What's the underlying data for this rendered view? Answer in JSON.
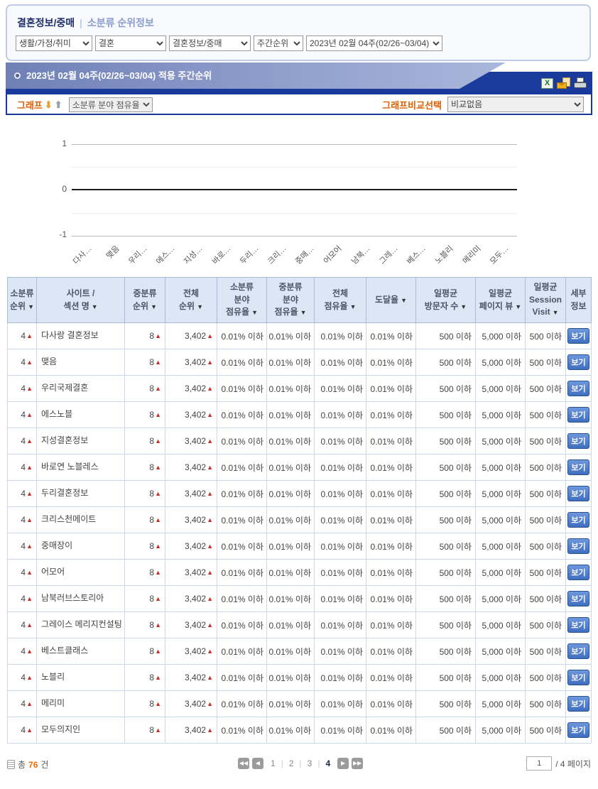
{
  "filter": {
    "title": "결혼정보/중매",
    "divider": "|",
    "subtitle": "소분류 순위정보",
    "selects": [
      "생활/가정/취미",
      "결혼",
      "결혼정보/중매",
      "주간순위",
      "2023년 02월 04주(02/26~03/04)"
    ]
  },
  "section": {
    "title": "2023년  02월  04주(02/26~03/04) 적용 주간순위",
    "graph_label": "그래프",
    "graph_select": "소분류 분야 점유율",
    "compare_label": "그래프비교선택",
    "compare_select": "비교없음",
    "icons": {
      "down": "⬇",
      "up": "⬆",
      "excel": "X"
    }
  },
  "chart_data": {
    "type": "line",
    "title": "",
    "categories": [
      "다사…",
      "맺음",
      "우리…",
      "에스…",
      "지성…",
      "바로…",
      "두리…",
      "크리…",
      "중매…",
      "어모어",
      "남북…",
      "그레…",
      "베스…",
      "노블리",
      "메리미",
      "모두…"
    ],
    "series": [],
    "ylim": [
      -1,
      1
    ],
    "yticks": [
      1,
      0,
      -1
    ],
    "ytick_labels": [
      "1",
      "0",
      "-1"
    ],
    "grid": true,
    "legend_position": "none"
  },
  "table": {
    "sort_glyph": "▼",
    "columns": [
      {
        "label": "소분류\n순위",
        "sort": true
      },
      {
        "label": "사이트 /\n섹션 명",
        "sort": true
      },
      {
        "label": "중분류\n순위",
        "sort": true
      },
      {
        "label": "전체\n순위",
        "sort": true
      },
      {
        "label": "소분류\n분야\n점유율",
        "sort": true
      },
      {
        "label": "중분류\n분야\n점유율",
        "sort": true
      },
      {
        "label": "전체\n점유율",
        "sort": true
      },
      {
        "label": "도달율",
        "sort": true
      },
      {
        "label": "일평균\n방문자 수",
        "sort": true
      },
      {
        "label": "일평균\n페이지 뷰",
        "sort": true
      },
      {
        "label": "일평균\nSession\nVisit",
        "sort": true
      },
      {
        "label": "세부\n정보",
        "sort": false
      }
    ],
    "rows": [
      {
        "rank": "4",
        "up": "▲",
        "site": "다사랑 결혼정보",
        "mid": "8",
        "mid_up": "▲",
        "total": "3,402",
        "total_up": "▲",
        "s1": "0.01% 이하",
        "s2": "0.01% 이하",
        "s3": "0.01% 이하",
        "s4": "0.01% 이하",
        "visitors": "500 이하",
        "pv": "5,000 이하",
        "session": "500 이하",
        "view": "보기"
      },
      {
        "rank": "4",
        "up": "▲",
        "site": "맺음",
        "mid": "8",
        "mid_up": "▲",
        "total": "3,402",
        "total_up": "▲",
        "s1": "0.01% 이하",
        "s2": "0.01% 이하",
        "s3": "0.01% 이하",
        "s4": "0.01% 이하",
        "visitors": "500 이하",
        "pv": "5,000 이하",
        "session": "500 이하",
        "view": "보기"
      },
      {
        "rank": "4",
        "up": "▲",
        "site": "우리국제결혼",
        "mid": "8",
        "mid_up": "▲",
        "total": "3,402",
        "total_up": "▲",
        "s1": "0.01% 이하",
        "s2": "0.01% 이하",
        "s3": "0.01% 이하",
        "s4": "0.01% 이하",
        "visitors": "500 이하",
        "pv": "5,000 이하",
        "session": "500 이하",
        "view": "보기"
      },
      {
        "rank": "4",
        "up": "▲",
        "site": "에스노블",
        "mid": "8",
        "mid_up": "▲",
        "total": "3,402",
        "total_up": "▲",
        "s1": "0.01% 이하",
        "s2": "0.01% 이하",
        "s3": "0.01% 이하",
        "s4": "0.01% 이하",
        "visitors": "500 이하",
        "pv": "5,000 이하",
        "session": "500 이하",
        "view": "보기"
      },
      {
        "rank": "4",
        "up": "▲",
        "site": "지성결혼정보",
        "mid": "8",
        "mid_up": "▲",
        "total": "3,402",
        "total_up": "▲",
        "s1": "0.01% 이하",
        "s2": "0.01% 이하",
        "s3": "0.01% 이하",
        "s4": "0.01% 이하",
        "visitors": "500 이하",
        "pv": "5,000 이하",
        "session": "500 이하",
        "view": "보기"
      },
      {
        "rank": "4",
        "up": "▲",
        "site": "바로연 노블레스",
        "mid": "8",
        "mid_up": "▲",
        "total": "3,402",
        "total_up": "▲",
        "s1": "0.01% 이하",
        "s2": "0.01% 이하",
        "s3": "0.01% 이하",
        "s4": "0.01% 이하",
        "visitors": "500 이하",
        "pv": "5,000 이하",
        "session": "500 이하",
        "view": "보기"
      },
      {
        "rank": "4",
        "up": "▲",
        "site": "두리결혼정보",
        "mid": "8",
        "mid_up": "▲",
        "total": "3,402",
        "total_up": "▲",
        "s1": "0.01% 이하",
        "s2": "0.01% 이하",
        "s3": "0.01% 이하",
        "s4": "0.01% 이하",
        "visitors": "500 이하",
        "pv": "5,000 이하",
        "session": "500 이하",
        "view": "보기"
      },
      {
        "rank": "4",
        "up": "▲",
        "site": "크리스천메이트",
        "mid": "8",
        "mid_up": "▲",
        "total": "3,402",
        "total_up": "▲",
        "s1": "0.01% 이하",
        "s2": "0.01% 이하",
        "s3": "0.01% 이하",
        "s4": "0.01% 이하",
        "visitors": "500 이하",
        "pv": "5,000 이하",
        "session": "500 이하",
        "view": "보기"
      },
      {
        "rank": "4",
        "up": "▲",
        "site": "중매장이",
        "mid": "8",
        "mid_up": "▲",
        "total": "3,402",
        "total_up": "▲",
        "s1": "0.01% 이하",
        "s2": "0.01% 이하",
        "s3": "0.01% 이하",
        "s4": "0.01% 이하",
        "visitors": "500 이하",
        "pv": "5,000 이하",
        "session": "500 이하",
        "view": "보기"
      },
      {
        "rank": "4",
        "up": "▲",
        "site": "어모어",
        "mid": "8",
        "mid_up": "▲",
        "total": "3,402",
        "total_up": "▲",
        "s1": "0.01% 이하",
        "s2": "0.01% 이하",
        "s3": "0.01% 이하",
        "s4": "0.01% 이하",
        "visitors": "500 이하",
        "pv": "5,000 이하",
        "session": "500 이하",
        "view": "보기"
      },
      {
        "rank": "4",
        "up": "▲",
        "site": "남북러브스토리아",
        "mid": "8",
        "mid_up": "▲",
        "total": "3,402",
        "total_up": "▲",
        "s1": "0.01% 이하",
        "s2": "0.01% 이하",
        "s3": "0.01% 이하",
        "s4": "0.01% 이하",
        "visitors": "500 이하",
        "pv": "5,000 이하",
        "session": "500 이하",
        "view": "보기"
      },
      {
        "rank": "4",
        "up": "▲",
        "site": "그레이스 메리지컨설팅",
        "mid": "8",
        "mid_up": "▲",
        "total": "3,402",
        "total_up": "▲",
        "s1": "0.01% 이하",
        "s2": "0.01% 이하",
        "s3": "0.01% 이하",
        "s4": "0.01% 이하",
        "visitors": "500 이하",
        "pv": "5,000 이하",
        "session": "500 이하",
        "view": "보기"
      },
      {
        "rank": "4",
        "up": "▲",
        "site": "베스트클래스",
        "mid": "8",
        "mid_up": "▲",
        "total": "3,402",
        "total_up": "▲",
        "s1": "0.01% 이하",
        "s2": "0.01% 이하",
        "s3": "0.01% 이하",
        "s4": "0.01% 이하",
        "visitors": "500 이하",
        "pv": "5,000 이하",
        "session": "500 이하",
        "view": "보기"
      },
      {
        "rank": "4",
        "up": "▲",
        "site": "노블리",
        "mid": "8",
        "mid_up": "▲",
        "total": "3,402",
        "total_up": "▲",
        "s1": "0.01% 이하",
        "s2": "0.01% 이하",
        "s3": "0.01% 이하",
        "s4": "0.01% 이하",
        "visitors": "500 이하",
        "pv": "5,000 이하",
        "session": "500 이하",
        "view": "보기"
      },
      {
        "rank": "4",
        "up": "▲",
        "site": "메리미",
        "mid": "8",
        "mid_up": "▲",
        "total": "3,402",
        "total_up": "▲",
        "s1": "0.01% 이하",
        "s2": "0.01% 이하",
        "s3": "0.01% 이하",
        "s4": "0.01% 이하",
        "visitors": "500 이하",
        "pv": "5,000 이하",
        "session": "500 이하",
        "view": "보기"
      },
      {
        "rank": "4",
        "up": "▲",
        "site": "모두의지인",
        "mid": "8",
        "mid_up": "▲",
        "total": "3,402",
        "total_up": "▲",
        "s1": "0.01% 이하",
        "s2": "0.01% 이하",
        "s3": "0.01% 이하",
        "s4": "0.01% 이하",
        "visitors": "500 이하",
        "pv": "5,000 이하",
        "session": "500 이하",
        "view": "보기"
      }
    ]
  },
  "footer": {
    "total_prefix": "총",
    "total_count": "76",
    "total_suffix": "건",
    "first": "◀◀",
    "prev": "◀",
    "next": "▶",
    "last": "▶▶",
    "pages": [
      "1",
      "2",
      "3",
      "4"
    ],
    "current": "4",
    "page_input": "1",
    "page_suffix": "/ 4 페이지"
  }
}
